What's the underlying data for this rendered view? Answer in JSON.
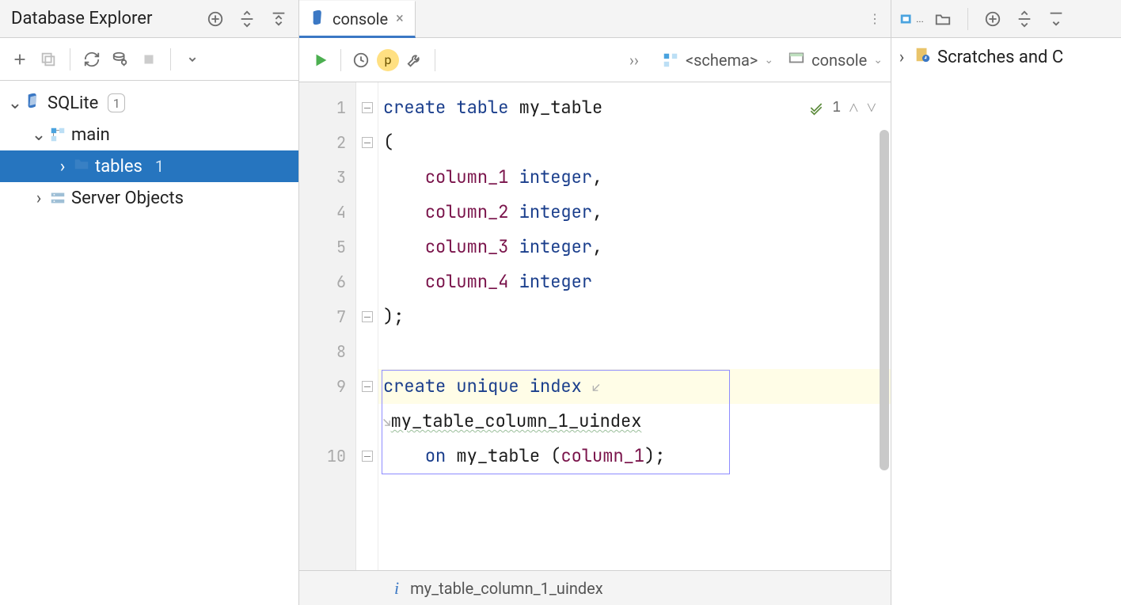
{
  "left": {
    "title": "Database Explorer",
    "tree": {
      "db_name": "SQLite",
      "db_badge": "1",
      "schema": "main",
      "tables_label": "tables",
      "tables_count": "1",
      "server_objects": "Server Objects"
    }
  },
  "mid": {
    "tab_label": "console",
    "crumb_schema": "<schema>",
    "crumb_console": "console",
    "p_badge": "p",
    "inspection_count": "1",
    "code_lines": [
      "1",
      "2",
      "3",
      "4",
      "5",
      "6",
      "7",
      "8",
      "9",
      "",
      "10"
    ],
    "code": {
      "l1_a": "create",
      "l1_b": "table",
      "l1_c": "my_table",
      "l2": "(",
      "l3_a": "column_1",
      "l3_b": "integer",
      "l3_c": ",",
      "l4_a": "column_2",
      "l4_b": "integer",
      "l4_c": ",",
      "l5_a": "column_3",
      "l5_b": "integer",
      "l5_c": ",",
      "l6_a": "column_4",
      "l6_b": "integer",
      "l7": ");",
      "l9_a": "create",
      "l9_b": "unique",
      "l9_c": "index",
      "l9x": "my_table_column_1_uindex",
      "l10_a": "on",
      "l10_b": "my_table",
      "l10_c": "(",
      "l10_d": "column_1",
      "l10_e": ");"
    },
    "status_text": "my_table_column_1_uindex"
  },
  "right": {
    "scratches": "Scratches and C"
  }
}
